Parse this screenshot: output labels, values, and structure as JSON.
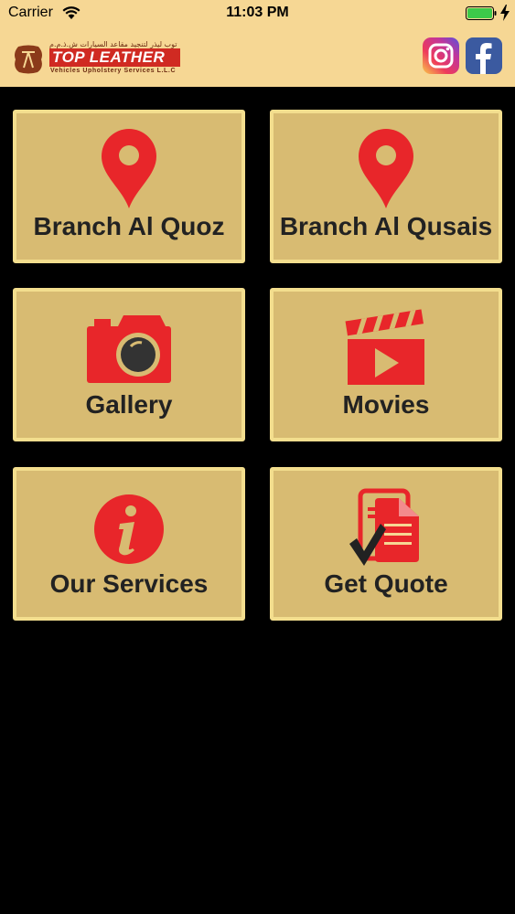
{
  "status_bar": {
    "carrier": "Carrier",
    "time": "11:03 PM",
    "battery_color": "#3cc94a"
  },
  "header": {
    "logo_arabic": "توب ليذر لتنجيد مقاعد السيارات ش.ذ.م.م",
    "logo_name": "TOP LEATHER",
    "logo_tagline": "Vehicles Upholstery Services L.L.C",
    "social": [
      "instagram-icon",
      "facebook-icon"
    ]
  },
  "tiles": [
    {
      "label": "Branch Al Quoz",
      "icon": "location-pin-icon"
    },
    {
      "label": "Branch Al Qusais",
      "icon": "location-pin-icon"
    },
    {
      "label": "Gallery",
      "icon": "camera-icon"
    },
    {
      "label": "Movies",
      "icon": "clapperboard-icon"
    },
    {
      "label": "Our Services",
      "icon": "info-icon"
    },
    {
      "label": "Get Quote",
      "icon": "quote-document-icon"
    }
  ],
  "colors": {
    "accent_red": "#e8262a",
    "tile_bg": "#d8bb72",
    "tile_border": "#f3de8e",
    "header_bg": "#f6d794"
  }
}
